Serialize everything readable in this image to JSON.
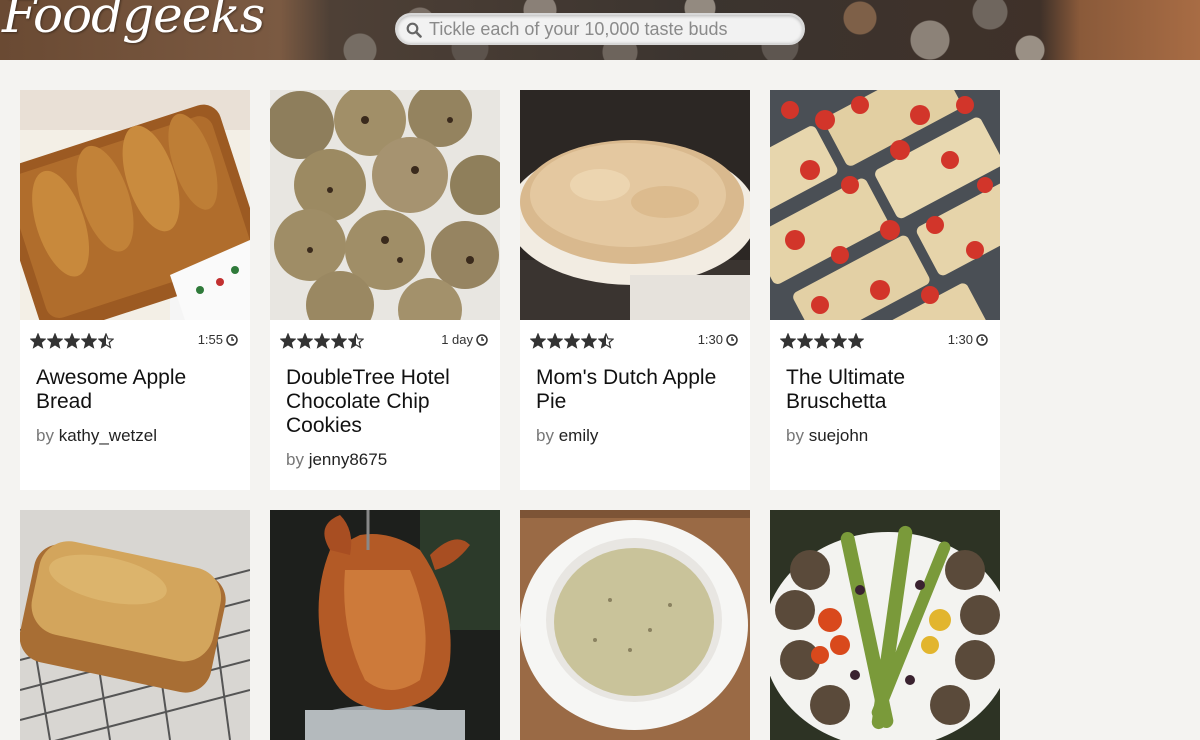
{
  "brand": {
    "name": "Foodgeeks"
  },
  "search": {
    "placeholder": "Tickle each of your 10,000 taste buds"
  },
  "cards": [
    {
      "title": "Awesome Apple Bread",
      "by": "by",
      "author": "kathy_wetzel",
      "time": "1:55",
      "rating": 4.5,
      "thumb_color": "#a8662c"
    },
    {
      "title": "DoubleTree Hotel Chocolate Chip Cookies",
      "by": "by",
      "author": "jenny8675",
      "time": "1 day",
      "rating": 4.5,
      "thumb_color": "#9a8a6a"
    },
    {
      "title": "Mom's Dutch Apple Pie",
      "by": "by",
      "author": "emily",
      "time": "1:30",
      "rating": 4.5,
      "thumb_color": "#d4b58c"
    },
    {
      "title": "The Ultimate Bruschetta",
      "by": "by",
      "author": "suejohn",
      "time": "1:30",
      "rating": 5,
      "thumb_color": "#c9392e"
    },
    {
      "thumb_color": "#c9954a"
    },
    {
      "thumb_color": "#b0582a"
    },
    {
      "thumb_color": "#c9c39a"
    },
    {
      "thumb_color": "#6e7a3a"
    }
  ],
  "colors": {
    "background": "#f4f3f1",
    "star": "#333333"
  }
}
